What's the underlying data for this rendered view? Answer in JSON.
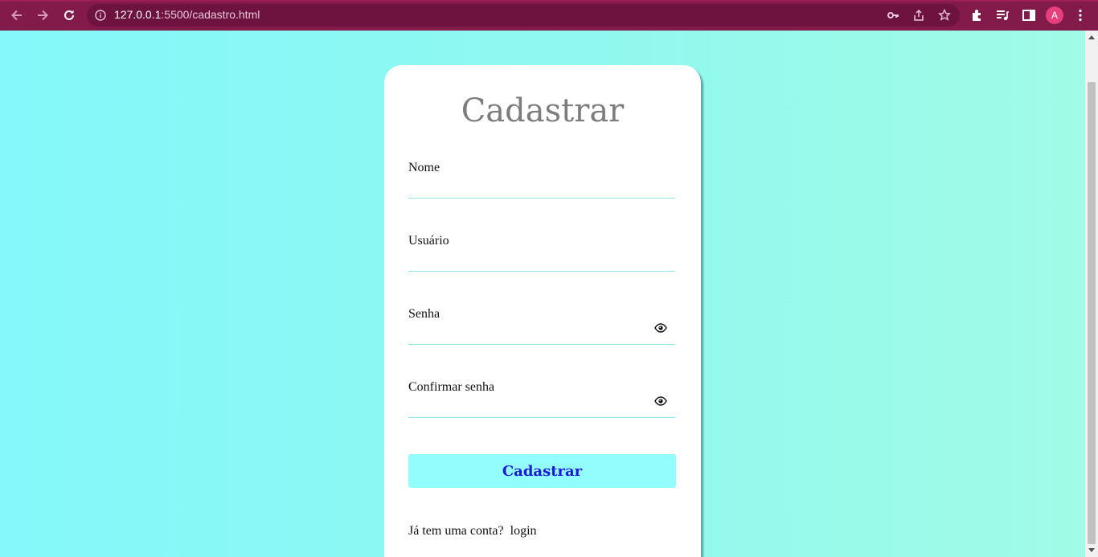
{
  "browser": {
    "url_host": "127.0.0.1",
    "url_rest": ":5500/cadastro.html",
    "profile_initial": "A",
    "accent": "#821b49"
  },
  "form": {
    "title": "Cadastrar",
    "fields": [
      {
        "label": "Nome",
        "value": "",
        "type": "text"
      },
      {
        "label": "Usuário",
        "value": "",
        "type": "text"
      },
      {
        "label": "Senha",
        "value": "",
        "type": "password",
        "icon": "eye-icon"
      },
      {
        "label": "Confirmar senha",
        "value": "",
        "type": "password",
        "icon": "eye-icon"
      }
    ],
    "submit_label": "Cadastrar",
    "submit_bg": "#93fdfd",
    "footer_text": "Já tem uma conta?",
    "footer_link": "login"
  }
}
